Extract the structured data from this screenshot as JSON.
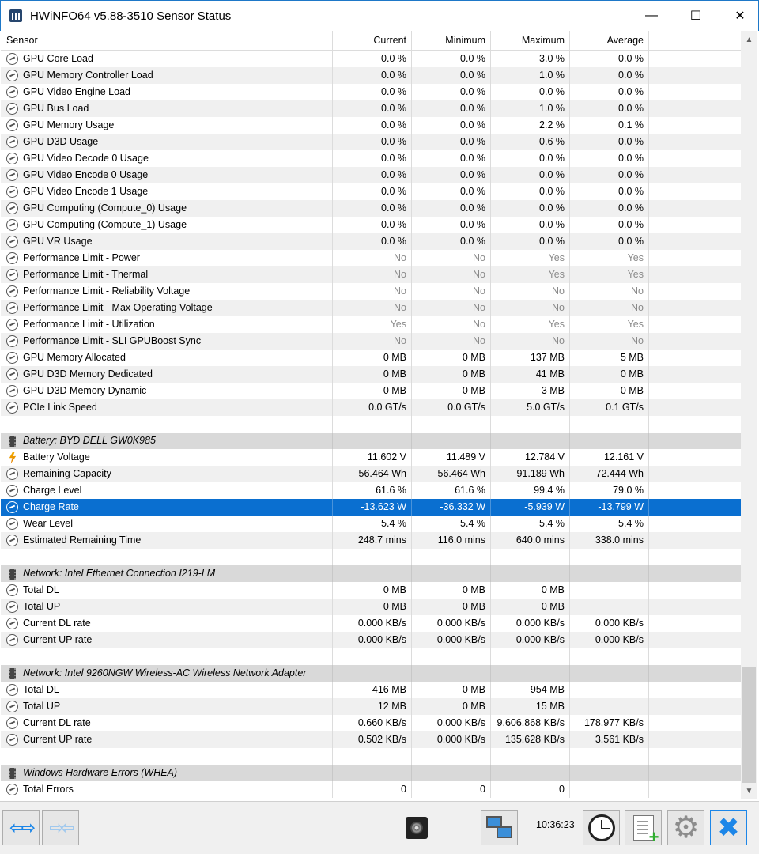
{
  "window": {
    "title": "HWiNFO64 v5.88-3510 Sensor Status",
    "minimize": "—",
    "maximize": "☐",
    "close": "✕"
  },
  "columns": {
    "sensor": "Sensor",
    "current": "Current",
    "minimum": "Minimum",
    "maximum": "Maximum",
    "average": "Average"
  },
  "rows": [
    {
      "kind": "gauge",
      "name": "GPU Core Load",
      "cur": "0.0 %",
      "min": "0.0 %",
      "max": "3.0 %",
      "avg": "0.0 %"
    },
    {
      "kind": "gauge",
      "name": "GPU Memory Controller Load",
      "cur": "0.0 %",
      "min": "0.0 %",
      "max": "1.0 %",
      "avg": "0.0 %"
    },
    {
      "kind": "gauge",
      "name": "GPU Video Engine Load",
      "cur": "0.0 %",
      "min": "0.0 %",
      "max": "0.0 %",
      "avg": "0.0 %"
    },
    {
      "kind": "gauge",
      "name": "GPU Bus Load",
      "cur": "0.0 %",
      "min": "0.0 %",
      "max": "1.0 %",
      "avg": "0.0 %"
    },
    {
      "kind": "gauge",
      "name": "GPU Memory Usage",
      "cur": "0.0 %",
      "min": "0.0 %",
      "max": "2.2 %",
      "avg": "0.1 %"
    },
    {
      "kind": "gauge",
      "name": "GPU D3D Usage",
      "cur": "0.0 %",
      "min": "0.0 %",
      "max": "0.6 %",
      "avg": "0.0 %"
    },
    {
      "kind": "gauge",
      "name": "GPU Video Decode 0 Usage",
      "cur": "0.0 %",
      "min": "0.0 %",
      "max": "0.0 %",
      "avg": "0.0 %"
    },
    {
      "kind": "gauge",
      "name": "GPU Video Encode 0 Usage",
      "cur": "0.0 %",
      "min": "0.0 %",
      "max": "0.0 %",
      "avg": "0.0 %"
    },
    {
      "kind": "gauge",
      "name": "GPU Video Encode 1 Usage",
      "cur": "0.0 %",
      "min": "0.0 %",
      "max": "0.0 %",
      "avg": "0.0 %"
    },
    {
      "kind": "gauge",
      "name": "GPU Computing (Compute_0) Usage",
      "cur": "0.0 %",
      "min": "0.0 %",
      "max": "0.0 %",
      "avg": "0.0 %"
    },
    {
      "kind": "gauge",
      "name": "GPU Computing (Compute_1) Usage",
      "cur": "0.0 %",
      "min": "0.0 %",
      "max": "0.0 %",
      "avg": "0.0 %"
    },
    {
      "kind": "gauge",
      "name": "GPU VR Usage",
      "cur": "0.0 %",
      "min": "0.0 %",
      "max": "0.0 %",
      "avg": "0.0 %"
    },
    {
      "kind": "gauge",
      "grey": true,
      "name": "Performance Limit - Power",
      "cur": "No",
      "min": "No",
      "max": "Yes",
      "avg": "Yes"
    },
    {
      "kind": "gauge",
      "grey": true,
      "name": "Performance Limit - Thermal",
      "cur": "No",
      "min": "No",
      "max": "Yes",
      "avg": "Yes"
    },
    {
      "kind": "gauge",
      "grey": true,
      "name": "Performance Limit - Reliability Voltage",
      "cur": "No",
      "min": "No",
      "max": "No",
      "avg": "No"
    },
    {
      "kind": "gauge",
      "grey": true,
      "name": "Performance Limit - Max Operating Voltage",
      "cur": "No",
      "min": "No",
      "max": "No",
      "avg": "No"
    },
    {
      "kind": "gauge",
      "grey": true,
      "name": "Performance Limit - Utilization",
      "cur": "Yes",
      "min": "No",
      "max": "Yes",
      "avg": "Yes"
    },
    {
      "kind": "gauge",
      "grey": true,
      "name": "Performance Limit - SLI GPUBoost Sync",
      "cur": "No",
      "min": "No",
      "max": "No",
      "avg": "No"
    },
    {
      "kind": "gauge",
      "name": "GPU Memory Allocated",
      "cur": "0 MB",
      "min": "0 MB",
      "max": "137 MB",
      "avg": "5 MB"
    },
    {
      "kind": "gauge",
      "name": "GPU D3D Memory Dedicated",
      "cur": "0 MB",
      "min": "0 MB",
      "max": "41 MB",
      "avg": "0 MB"
    },
    {
      "kind": "gauge",
      "name": "GPU D3D Memory Dynamic",
      "cur": "0 MB",
      "min": "0 MB",
      "max": "3 MB",
      "avg": "0 MB"
    },
    {
      "kind": "gauge",
      "name": "PCIe Link Speed",
      "cur": "0.0 GT/s",
      "min": "0.0 GT/s",
      "max": "5.0 GT/s",
      "avg": "0.1 GT/s"
    },
    {
      "kind": "blank"
    },
    {
      "kind": "group",
      "name": "Battery: BYD DELL GW0K985"
    },
    {
      "kind": "bolt",
      "name": "Battery Voltage",
      "cur": "11.602 V",
      "min": "11.489 V",
      "max": "12.784 V",
      "avg": "12.161 V"
    },
    {
      "kind": "gauge",
      "name": "Remaining Capacity",
      "cur": "56.464 Wh",
      "min": "56.464 Wh",
      "max": "91.189 Wh",
      "avg": "72.444 Wh"
    },
    {
      "kind": "gauge",
      "name": "Charge Level",
      "cur": "61.6 %",
      "min": "61.6 %",
      "max": "99.4 %",
      "avg": "79.0 %"
    },
    {
      "kind": "gauge",
      "selected": true,
      "name": "Charge Rate",
      "cur": "-13.623 W",
      "min": "-36.332 W",
      "max": "-5.939 W",
      "avg": "-13.799 W"
    },
    {
      "kind": "gauge",
      "name": "Wear Level",
      "cur": "5.4 %",
      "min": "5.4 %",
      "max": "5.4 %",
      "avg": "5.4 %"
    },
    {
      "kind": "gauge",
      "name": "Estimated Remaining Time",
      "cur": "248.7 mins",
      "min": "116.0 mins",
      "max": "640.0 mins",
      "avg": "338.0 mins"
    },
    {
      "kind": "blank"
    },
    {
      "kind": "group",
      "name": "Network: Intel Ethernet Connection I219-LM"
    },
    {
      "kind": "gauge",
      "name": "Total DL",
      "cur": "0 MB",
      "min": "0 MB",
      "max": "0 MB",
      "avg": ""
    },
    {
      "kind": "gauge",
      "name": "Total UP",
      "cur": "0 MB",
      "min": "0 MB",
      "max": "0 MB",
      "avg": ""
    },
    {
      "kind": "gauge",
      "name": "Current DL rate",
      "cur": "0.000 KB/s",
      "min": "0.000 KB/s",
      "max": "0.000 KB/s",
      "avg": "0.000 KB/s"
    },
    {
      "kind": "gauge",
      "name": "Current UP rate",
      "cur": "0.000 KB/s",
      "min": "0.000 KB/s",
      "max": "0.000 KB/s",
      "avg": "0.000 KB/s"
    },
    {
      "kind": "blank"
    },
    {
      "kind": "group",
      "name": "Network: Intel 9260NGW Wireless-AC Wireless Network Adapter"
    },
    {
      "kind": "gauge",
      "name": "Total DL",
      "cur": "416 MB",
      "min": "0 MB",
      "max": "954 MB",
      "avg": ""
    },
    {
      "kind": "gauge",
      "name": "Total UP",
      "cur": "12 MB",
      "min": "0 MB",
      "max": "15 MB",
      "avg": ""
    },
    {
      "kind": "gauge",
      "name": "Current DL rate",
      "cur": "0.660 KB/s",
      "min": "0.000 KB/s",
      "max": "9,606.868 KB/s",
      "avg": "178.977 KB/s"
    },
    {
      "kind": "gauge",
      "name": "Current UP rate",
      "cur": "0.502 KB/s",
      "min": "0.000 KB/s",
      "max": "135.628 KB/s",
      "avg": "3.561 KB/s"
    },
    {
      "kind": "blank"
    },
    {
      "kind": "group",
      "name": "Windows Hardware Errors (WHEA)"
    },
    {
      "kind": "gauge",
      "name": "Total Errors",
      "cur": "0",
      "min": "0",
      "max": "0",
      "avg": ""
    }
  ],
  "toolbar": {
    "clock": "10:36:23",
    "icons": {
      "expand": "arrows-expand-icon",
      "collapse": "arrows-collapse-icon",
      "fan": "fan-icon",
      "network": "network-icon",
      "clock": "clock-icon",
      "report": "report-add-icon",
      "settings": "gear-icon",
      "close": "close-icon"
    }
  },
  "colors": {
    "selected_row": "#0a6fd0",
    "group_row": "#d9d9d9",
    "alt_row": "#f0f0f0",
    "accent": "#1c86e8"
  }
}
